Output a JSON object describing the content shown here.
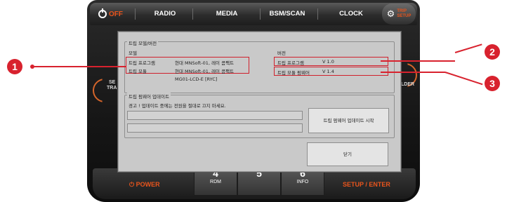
{
  "top_bar": {
    "off_label": "OFF",
    "items": [
      "RADIO",
      "MEDIA",
      "BSM/SCAN",
      "CLOCK"
    ],
    "trip_setup_line1": "TRIP",
    "trip_setup_line2": "SETUP"
  },
  "side": {
    "left_fragment_1": "SE",
    "left_fragment_2": "TRA",
    "right_fragment": "LDER"
  },
  "bottom_bar": {
    "power_label": "POWER",
    "setup_enter_label": "SETUP / ENTER",
    "keys": [
      {
        "num": "4",
        "sub": "RDM"
      },
      {
        "num": "5",
        "sub": ""
      },
      {
        "num": "6",
        "sub": "INFO"
      }
    ]
  },
  "dialog": {
    "model_version_group_title": "트립 모델/버전",
    "model_header": "모델",
    "version_header": "버전",
    "model_rows": [
      {
        "label": "트립 프로그램",
        "value": "현대 MNSoft-01, 레이 콤팩트"
      },
      {
        "label": "트립 모듈",
        "value": "현대 MNSoft-01, 레이 콤팩트"
      }
    ],
    "model_extra": "MG01-LCD-E [RYC]",
    "version_rows": [
      {
        "label": "트립 프로그램",
        "value": "V 1.0"
      },
      {
        "label": "트립 모듈 펌웨어",
        "value": "V 1.4"
      }
    ],
    "firmware_group_title": "트립 펌웨어 업데이트",
    "warning_text": "경고 ! 업데이트 중에는 전원을 절대로 끄지 마세요.",
    "start_update_button": "트립 펌웨어 업데이트 시작",
    "close_button": "닫기"
  },
  "callouts": [
    "1",
    "2",
    "3"
  ],
  "colors": {
    "accent_orange": "#e8541c",
    "callout_red": "#d8222e",
    "dialog_bg": "#c9c9c9"
  }
}
